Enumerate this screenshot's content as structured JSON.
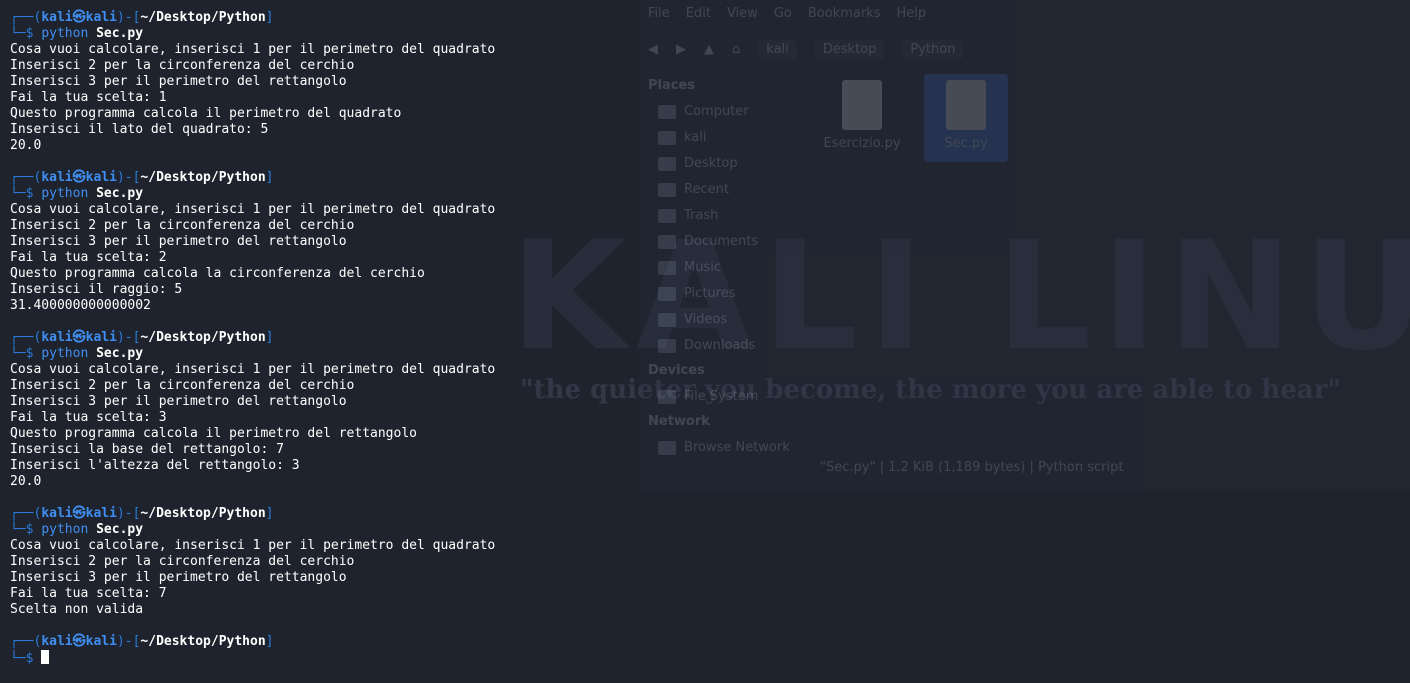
{
  "background_window": {
    "menu": [
      "File",
      "Edit",
      "View",
      "Go",
      "Bookmarks",
      "Help"
    ],
    "path_segments": [
      "kali",
      "Desktop",
      "Python"
    ],
    "places_heading": "Places",
    "places": [
      "Computer",
      "kali",
      "Desktop",
      "Recent",
      "Trash",
      "Documents",
      "Music",
      "Pictures",
      "Videos",
      "Downloads"
    ],
    "devices_heading": "Devices",
    "devices": [
      "File System"
    ],
    "network_heading": "Network",
    "network": [
      "Browse Network"
    ],
    "files": [
      "Esercizio.py",
      "Sec.py"
    ],
    "status": "\"Sec.py\" | 1.2 KiB (1,189 bytes) | Python script"
  },
  "wallpaper": {
    "logo_text": "KALI LINUX",
    "quote": "\"the quieter you become, the more you are able to hear\""
  },
  "terminal": {
    "prompt": {
      "frame_top": "┌──(",
      "user": "kali㉿kali",
      "mid": ")-[",
      "cwd": "~/Desktop/Python",
      "close": "]",
      "frame_bottom": "└─",
      "dollar": "$ "
    },
    "sessions": [
      {
        "command": "python",
        "arg": "Sec.py",
        "output": [
          "Cosa vuoi calcolare, inserisci 1 per il perimetro del quadrato",
          "Inserisci 2 per la circonferenza del cerchio",
          "Inserisci 3 per il perimetro del rettangolo",
          "Fai la tua scelta: 1",
          "Questo programma calcola il perimetro del quadrato",
          "Inserisci il lato del quadrato: 5",
          "20.0"
        ]
      },
      {
        "command": "python",
        "arg": "Sec.py",
        "output": [
          "Cosa vuoi calcolare, inserisci 1 per il perimetro del quadrato",
          "Inserisci 2 per la circonferenza del cerchio",
          "Inserisci 3 per il perimetro del rettangolo",
          "Fai la tua scelta: 2",
          "Questo programma calcola la circonferenza del cerchio",
          "Inserisci il raggio: 5",
          "31.400000000000002"
        ]
      },
      {
        "command": "python",
        "arg": "Sec.py",
        "output": [
          "Cosa vuoi calcolare, inserisci 1 per il perimetro del quadrato",
          "Inserisci 2 per la circonferenza del cerchio",
          "Inserisci 3 per il perimetro del rettangolo",
          "Fai la tua scelta: 3",
          "Questo programma calcola il perimetro del rettangolo",
          "Inserisci la base del rettangolo: 7",
          "Inserisci l'altezza del rettangolo: 3",
          "20.0"
        ]
      },
      {
        "command": "python",
        "arg": "Sec.py",
        "output": [
          "Cosa vuoi calcolare, inserisci 1 per il perimetro del quadrato",
          "Inserisci 2 per la circonferenza del cerchio",
          "Inserisci 3 per il perimetro del rettangolo",
          "Fai la tua scelta: 7",
          "Scelta non valida"
        ]
      }
    ]
  }
}
